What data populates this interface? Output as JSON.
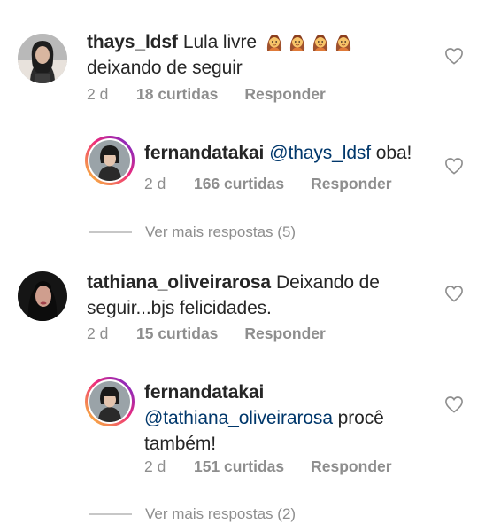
{
  "comments": [
    {
      "username": "thays_ldsf",
      "text_line1": "Lula livre",
      "emoji_count": 4,
      "text_line2": "deixando de seguir",
      "time": "2 d",
      "likes": "18 curtidas",
      "reply": "Responder"
    },
    {
      "username": "fernandatakai",
      "mention": "@thays_ldsf",
      "text": "oba!",
      "time": "2 d",
      "likes": "166 curtidas",
      "reply": "Responder"
    },
    {
      "more_replies": "Ver mais respostas (5)"
    },
    {
      "username": "tathiana_oliveirarosa",
      "text_line1": "Deixando de",
      "text_line2": "seguir...bjs felicidades.",
      "time": "2 d",
      "likes": "15 curtidas",
      "reply": "Responder"
    },
    {
      "username": "fernandatakai",
      "mention": "@tathiana_oliveirarosa",
      "text_line1": "procê",
      "text_line2": "também!",
      "time": "2 d",
      "likes": "151 curtidas",
      "reply": "Responder"
    },
    {
      "more_replies": "Ver mais respostas (2)"
    }
  ],
  "icons": {
    "like": "heart-outline-icon",
    "emoji": "woman-raising-hand-emoji"
  },
  "colors": {
    "text": "#262626",
    "secondary": "#8e8e8e",
    "mention": "#00376b",
    "story_ring_start": "#f9ce34",
    "story_ring_end": "#6228d7"
  }
}
